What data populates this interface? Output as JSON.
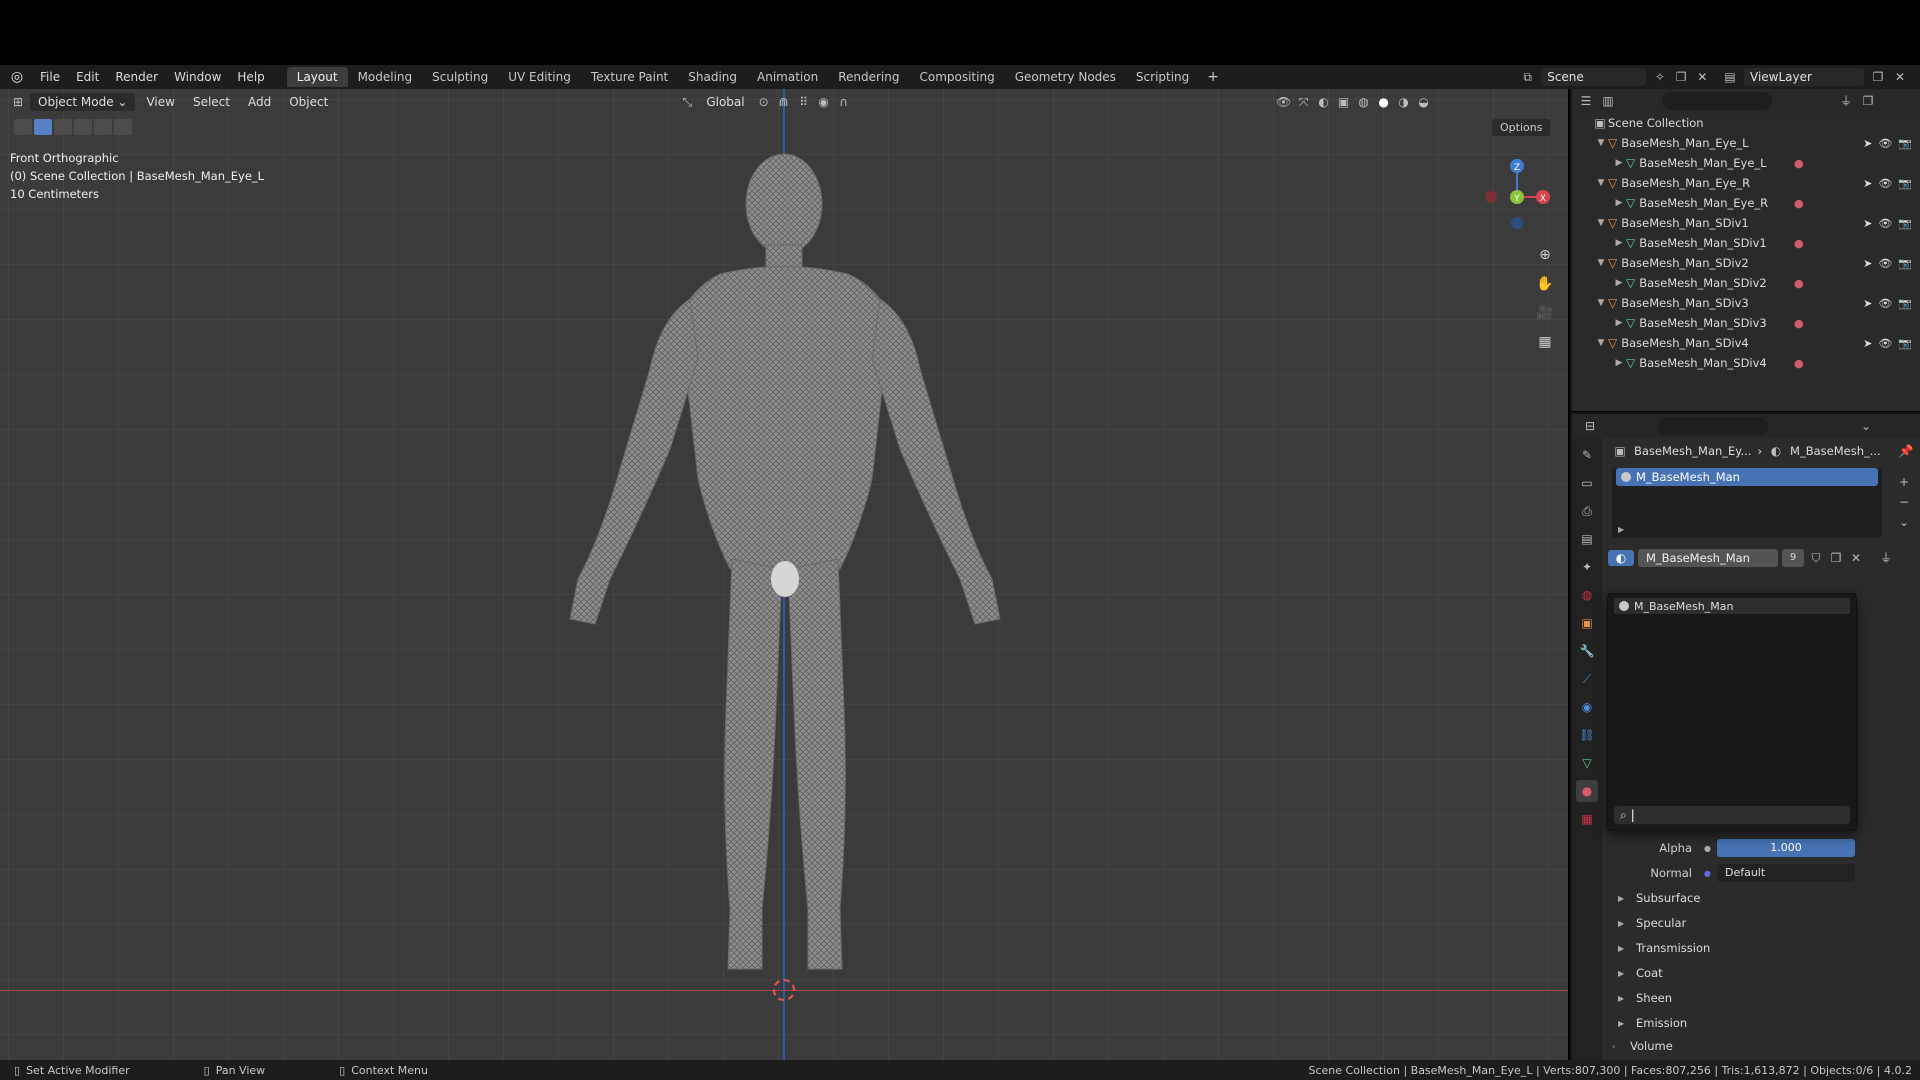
{
  "menubar": {
    "items": [
      "File",
      "Edit",
      "Render",
      "Window",
      "Help"
    ],
    "workspaces": [
      "Layout",
      "Modeling",
      "Sculpting",
      "UV Editing",
      "Texture Paint",
      "Shading",
      "Animation",
      "Rendering",
      "Compositing",
      "Geometry Nodes",
      "Scripting"
    ],
    "active_workspace": "Layout",
    "scene": "Scene",
    "view_layer": "ViewLayer"
  },
  "viewport": {
    "mode": "Object Mode",
    "menus": [
      "View",
      "Select",
      "Add",
      "Object"
    ],
    "orientation": "Global",
    "options_label": "Options",
    "overlay_view": "Front Orthographic",
    "overlay_collection": "(0) Scene Collection | BaseMesh_Man_Eye_L",
    "overlay_scale": "10 Centimeters",
    "gizmo": {
      "z": "Z",
      "y": "Y",
      "x": "X"
    }
  },
  "outliner": {
    "root": "Scene Collection",
    "items": [
      {
        "object": "BaseMesh_Man_Eye_L",
        "mesh": "BaseMesh_Man_Eye_L"
      },
      {
        "object": "BaseMesh_Man_Eye_R",
        "mesh": "BaseMesh_Man_Eye_R"
      },
      {
        "object": "BaseMesh_Man_SDiv1",
        "mesh": "BaseMesh_Man_SDiv1"
      },
      {
        "object": "BaseMesh_Man_SDiv2",
        "mesh": "BaseMesh_Man_SDiv2"
      },
      {
        "object": "BaseMesh_Man_SDiv3",
        "mesh": "BaseMesh_Man_SDiv3"
      },
      {
        "object": "BaseMesh_Man_SDiv4",
        "mesh": "BaseMesh_Man_SDiv4"
      }
    ]
  },
  "properties": {
    "breadcrumb_object": "BaseMesh_Man_Ey...",
    "breadcrumb_material": "M_BaseMesh_...",
    "slot_name": "M_BaseMesh_Man",
    "material_name": "M_BaseMesh_Man",
    "user_count": "9",
    "popup_item": "M_BaseMesh_Man",
    "alpha_label": "Alpha",
    "alpha_value": "1.000",
    "normal_label": "Normal",
    "normal_value": "Default",
    "sections": [
      "Subsurface",
      "Specular",
      "Transmission",
      "Coat",
      "Sheen",
      "Emission"
    ],
    "volume": "Volume"
  },
  "statusbar": {
    "left1": "Set Active Modifier",
    "left2": "Pan View",
    "left3": "Context Menu",
    "right": "Scene Collection | BaseMesh_Man_Eye_L | Verts:807,300 | Faces:807,256 | Tris:1,613,872 | Objects:0/6 | 4.0.2"
  },
  "colors": {
    "accent": "#4772b3",
    "object_icon": "#e8914a",
    "mesh_icon": "#5fce8b",
    "material_icon": "#d25a6b"
  }
}
